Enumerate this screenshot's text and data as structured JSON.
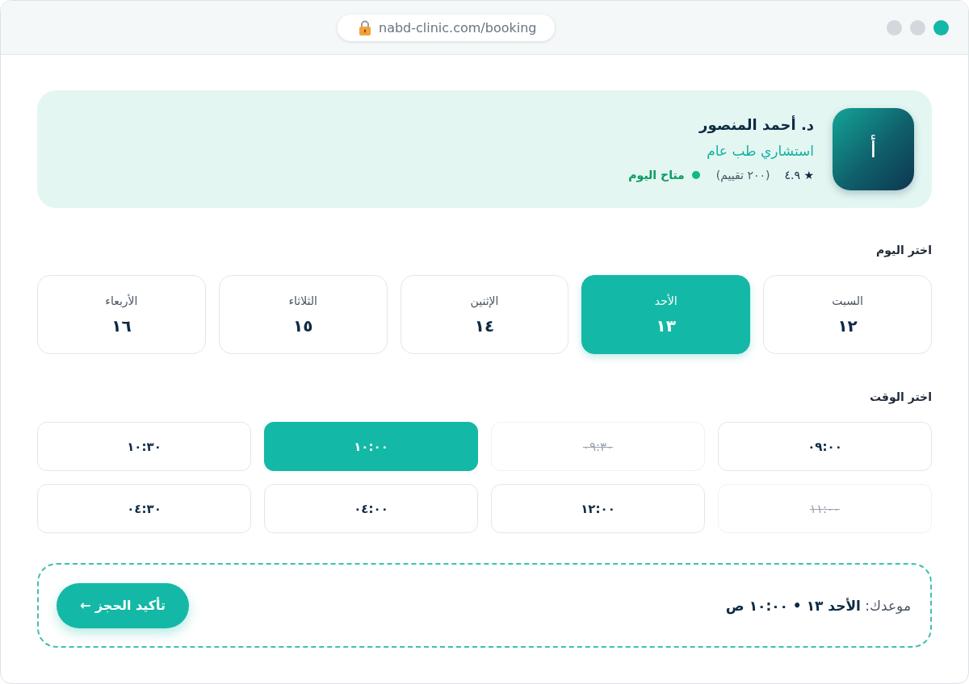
{
  "browser": {
    "url": "nabd-clinic.com/booking",
    "window_controls": [
      {
        "color": "#d4d7db"
      },
      {
        "color": "#d4d7db"
      },
      {
        "color": "#14b8a6"
      }
    ]
  },
  "doctor": {
    "initial": "أ",
    "name": "د. أحمد المنصور",
    "specialty": "استشاري طب عام",
    "rating": "★ ٤.٩",
    "reviews": "(٢٠٠ تقييم)",
    "available": true,
    "availability": "متاح اليوم"
  },
  "day_picker": {
    "label": "اختر اليوم",
    "days": [
      {
        "name": "السبت",
        "date": "١٢",
        "selected": false
      },
      {
        "name": "الأحد",
        "date": "١٣",
        "selected": true
      },
      {
        "name": "الإثنين",
        "date": "١٤",
        "selected": false
      },
      {
        "name": "الثلاثاء",
        "date": "١٥",
        "selected": false
      },
      {
        "name": "الأربعاء",
        "date": "١٦",
        "selected": false
      }
    ]
  },
  "time_picker": {
    "label": "اختر الوقت",
    "slots": [
      {
        "time": "٠٩:٠٠",
        "selected": false,
        "disabled": false
      },
      {
        "time": "٠٩:٣٠",
        "selected": false,
        "disabled": true
      },
      {
        "time": "١٠:٠٠",
        "selected": true,
        "disabled": false
      },
      {
        "time": "١٠:٣٠",
        "selected": false,
        "disabled": false
      },
      {
        "time": "١١:٠٠",
        "selected": false,
        "disabled": true
      },
      {
        "time": "١٢:٠٠",
        "selected": false,
        "disabled": false
      },
      {
        "time": "٠٤:٠٠",
        "selected": false,
        "disabled": false
      },
      {
        "time": "٠٤:٣٠",
        "selected": false,
        "disabled": false
      }
    ]
  },
  "summary": {
    "text": "موعدك: **الأحد ١٣ • ١٠:٠٠ ص**",
    "button": "تأكيد الحجز ←"
  }
}
